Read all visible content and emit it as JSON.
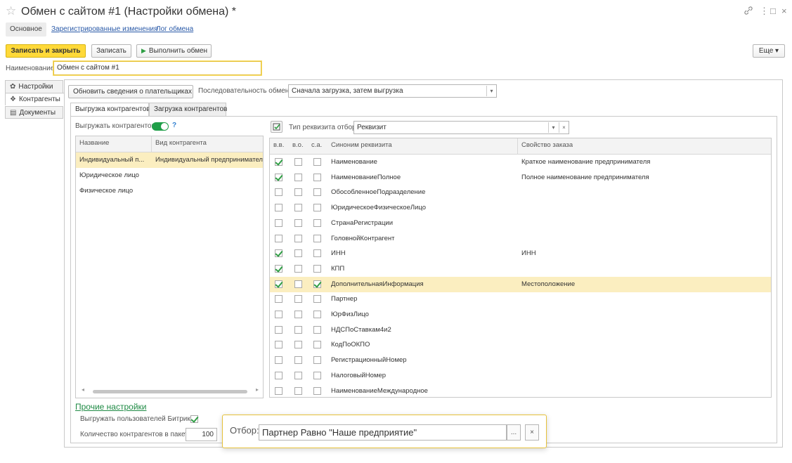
{
  "window": {
    "title": "Обмен с сайтом #1 (Настройки обмена) *",
    "star_icon": "☆",
    "link_icon": "🔗",
    "more_icon": "⋮",
    "maximize_icon": "□",
    "close_icon": "×"
  },
  "nav": {
    "tabs": [
      {
        "label": "Основное"
      },
      {
        "label": "Зарегистрированные изменения"
      },
      {
        "label": "Лог обмена"
      }
    ]
  },
  "toolbar": {
    "save_close_label": "Записать и закрыть",
    "save_label": "Записать",
    "run_label": "Выполнить обмен",
    "run_icon": "▶",
    "more_label": "Еще ▾"
  },
  "name_field": {
    "label": "Наименование:",
    "value": "Обмен с сайтом #1"
  },
  "side_tabs": [
    {
      "label": "Настройки",
      "icon": "✿"
    },
    {
      "label": "Контрагенты",
      "icon": "❖"
    },
    {
      "label": "Документы",
      "icon": "▤"
    }
  ],
  "settings": {
    "update_payers_label": "Обновить сведения о плательщиках",
    "sequence_label": "Последовательность обмена:",
    "sequence_value": "Сначала загрузка, затем выгрузка",
    "dropdown_icon": "▾"
  },
  "sub_tabs": [
    {
      "label": "Выгрузка контрагентов"
    },
    {
      "label": "Загрузка контрагентов"
    }
  ],
  "export_toggle_label": "Выгружать контрагентов:",
  "help_mark": "?",
  "left_grid": {
    "headers": [
      "Название",
      "Вид контрагента"
    ],
    "rows": [
      {
        "name": "Индивидуальный п...",
        "kind": "Индивидуальный предприниматель"
      },
      {
        "name": "Юридическое лицо",
        "kind": ""
      },
      {
        "name": "Физическое лицо",
        "kind": ""
      }
    ],
    "scroll_left": "◂",
    "scroll_right": "▸"
  },
  "filter": {
    "label": "Тип реквизита отбор:",
    "value": "Реквизит",
    "clear_icon": "×",
    "dropdown_icon": "▾"
  },
  "right_grid": {
    "headers": [
      "в.в.",
      "в.о.",
      "с.а.",
      "Синоним реквизита",
      "Свойство заказа"
    ],
    "rows": [
      {
        "vv": true,
        "vo": false,
        "sa": false,
        "synonym": "Наименование",
        "property": "Краткое наименование предпринимателя"
      },
      {
        "vv": true,
        "vo": false,
        "sa": false,
        "synonym": "НаименованиеПолное",
        "property": "Полное наименование предпринимателя"
      },
      {
        "vv": false,
        "vo": false,
        "sa": false,
        "synonym": "ОбособленноеПодразделение",
        "property": ""
      },
      {
        "vv": false,
        "vo": false,
        "sa": false,
        "synonym": "ЮридическоеФизическоеЛицо",
        "property": ""
      },
      {
        "vv": false,
        "vo": false,
        "sa": false,
        "synonym": "СтранаРегистрации",
        "property": ""
      },
      {
        "vv": false,
        "vo": false,
        "sa": false,
        "synonym": "ГоловнойКонтрагент",
        "property": ""
      },
      {
        "vv": true,
        "vo": false,
        "sa": false,
        "synonym": "ИНН",
        "property": "ИНН"
      },
      {
        "vv": true,
        "vo": false,
        "sa": false,
        "synonym": "КПП",
        "property": ""
      },
      {
        "vv": true,
        "vo": false,
        "sa": true,
        "synonym": "ДополнительнаяИнформация",
        "property": "Местоположение",
        "selected": true
      },
      {
        "vv": false,
        "vo": false,
        "sa": false,
        "synonym": "Партнер",
        "property": ""
      },
      {
        "vv": false,
        "vo": false,
        "sa": false,
        "synonym": "ЮрФизЛицо",
        "property": ""
      },
      {
        "vv": false,
        "vo": false,
        "sa": false,
        "synonym": "НДСПоСтавкам4и2",
        "property": ""
      },
      {
        "vv": false,
        "vo": false,
        "sa": false,
        "synonym": "КодПоОКПО",
        "property": ""
      },
      {
        "vv": false,
        "vo": false,
        "sa": false,
        "synonym": "РегистрационныйНомер",
        "property": ""
      },
      {
        "vv": false,
        "vo": false,
        "sa": false,
        "synonym": "НалоговыйНомер",
        "property": ""
      },
      {
        "vv": false,
        "vo": false,
        "sa": false,
        "synonym": "НаименованиеМеждународное",
        "property": ""
      }
    ]
  },
  "other_settings": {
    "title": "Прочие настройки",
    "export_bitrix_label": "Выгружать пользователей Битрикс:",
    "export_bitrix_checked": true,
    "batch_label": "Количество контрагентов в пакете:",
    "batch_value": "100"
  },
  "filter_popup": {
    "label": "Отбор:",
    "value": "Партнер Равно \"Наше предприятие\"",
    "ellipsis": "...",
    "clear_icon": "×"
  },
  "colors": {
    "accent_yellow": "#ffd939",
    "check_green": "#2f9e44",
    "link_blue": "#2a5aa8",
    "selected_row": "#fbeec0"
  }
}
